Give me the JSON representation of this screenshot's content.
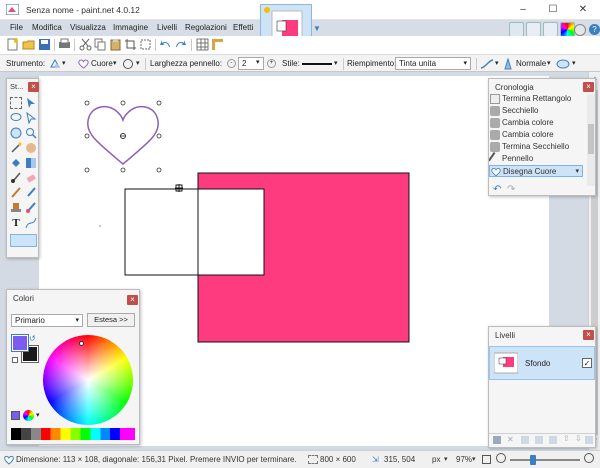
{
  "window": {
    "title": "Senza nome - paint.net 4.0.12",
    "minimize": "–",
    "maximize": "☐",
    "close": "✕"
  },
  "menu": {
    "items": [
      "File",
      "Modifica",
      "Visualizza",
      "Immagine",
      "Livelli",
      "Regolazioni",
      "Effetti"
    ]
  },
  "options": {
    "tool_label": "Strumento:",
    "shape_value": "Cuore",
    "brush_width_label": "Larghezza pennello:",
    "brush_width_value": "2",
    "style_label": "Stile:",
    "fill_label": "Riempimento:",
    "fill_value": "Tinta unita",
    "blend_value": "Normale"
  },
  "tools_panel": {
    "title": "St..."
  },
  "history_panel": {
    "title": "Cronologia",
    "items": [
      "Termina Rettangolo",
      "Secchiello",
      "Cambia colore",
      "Cambia colore",
      "Termina Secchiello",
      "Pennello",
      "Disegna Cuore"
    ],
    "selected_index": 6
  },
  "colors_panel": {
    "title": "Colori",
    "mode": "Primario",
    "more_button": "Estesa >>",
    "primary_color": "#7a5cf0",
    "secondary_color": "#1a1a1a"
  },
  "layers_panel": {
    "title": "Livelli",
    "layers": [
      {
        "name": "Sfondo",
        "visible": true
      }
    ]
  },
  "status": {
    "message": "Dimensione: 113 × 108, diagonale: 156,31 Pixel. Premere INVIO per terminare.",
    "image_size": "800 × 600",
    "cursor_pos": "315, 504",
    "unit": "px",
    "zoom": "97%"
  },
  "colors": {
    "pink": "#ff3b80",
    "heart_stroke": "#8b5fbf",
    "accent_blue": "#3c7fc1"
  }
}
